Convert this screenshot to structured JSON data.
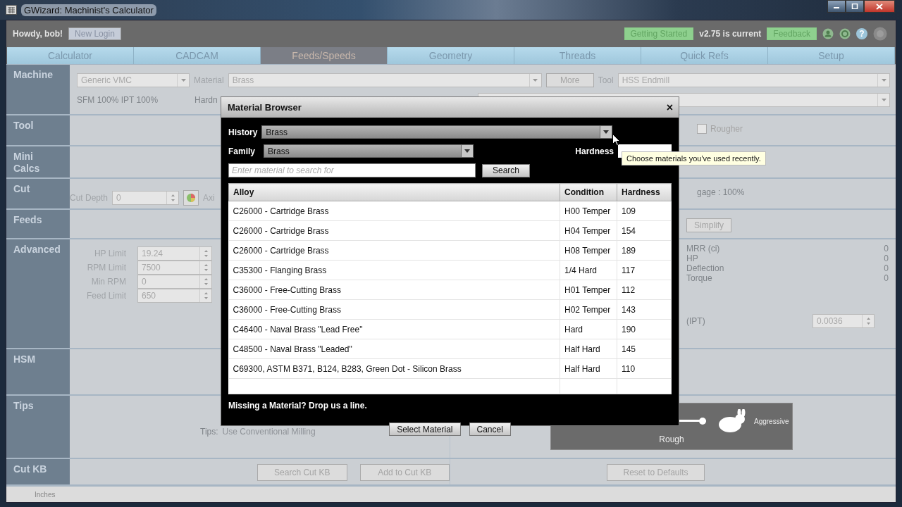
{
  "window": {
    "title": "GWizard: Machinist's Calculator"
  },
  "header": {
    "greeting": "Howdy, bob!",
    "new_login": "New Login",
    "getting_started": "Getting Started",
    "version": "v2.75 is current",
    "feedback": "Feedback",
    "help": "?"
  },
  "tabs": [
    {
      "label": "Calculator",
      "selected": false
    },
    {
      "label": "CADCAM",
      "selected": false
    },
    {
      "label": "Feeds/Speeds",
      "selected": true
    },
    {
      "label": "Geometry",
      "selected": false
    },
    {
      "label": "Threads",
      "selected": false
    },
    {
      "label": "Quick Refs",
      "selected": false
    },
    {
      "label": "Setup",
      "selected": false
    }
  ],
  "machine": {
    "label": "Machine",
    "machine_value": "Generic VMC",
    "material_label": "Material",
    "material_value": "Brass",
    "more": "More",
    "tool_label": "Tool",
    "tool_value": "HSS Endmill",
    "stats": "SFM 100%  IPT 100%",
    "hardness": "Hardn"
  },
  "tool": {
    "label": "Tool",
    "rougher": {
      "label": "Rougher",
      "checked": false
    }
  },
  "mini_calcs": {
    "label": "Mini Calcs"
  },
  "cut": {
    "label": "Cut",
    "depth_label": "Cut Depth",
    "depth_value": "0",
    "axial": "Axi",
    "engagement": "gage : 100%"
  },
  "feeds": {
    "label": "Feeds",
    "simplify": "Simplify"
  },
  "advanced": {
    "label": "Advanced",
    "limits": [
      {
        "label": "HP Limit",
        "value": "19.24"
      },
      {
        "label": "RPM Limit",
        "value": "7500"
      },
      {
        "label": "Min RPM",
        "value": "0"
      },
      {
        "label": "Feed Limit",
        "value": "650"
      }
    ],
    "readouts": [
      {
        "label": "MRR (ci)",
        "value": "0"
      },
      {
        "label": "HP",
        "value": "0"
      },
      {
        "label": "Deflection",
        "value": "0"
      },
      {
        "label": "Torque",
        "value": "0"
      }
    ],
    "ipt_label": "(IPT)",
    "ipt_value": "0.0036"
  },
  "hsm": {
    "label": "HSM"
  },
  "tips": {
    "label": "Tips",
    "tips_label": "Tips:",
    "tip": "Use Conventional Milling",
    "slider": {
      "level": 1,
      "low": "Rough",
      "high": "Aggressive"
    }
  },
  "cut_kb": {
    "label": "Cut KB",
    "buttons": [
      "Search Cut KB",
      "Add to Cut KB",
      "Reset to Defaults"
    ]
  },
  "status_bar": {
    "units": "Inches"
  },
  "dialog": {
    "title": "Material Browser",
    "close": "×",
    "history_label": "History",
    "history_value": "Brass",
    "family_label": "Family",
    "family_value": "Brass",
    "hardness_label": "Hardness",
    "search_placeholder": "Enter material to search for",
    "search_button": "Search",
    "columns": [
      "Alloy",
      "Condition",
      "Hardness"
    ],
    "rows": [
      [
        "C26000 - Cartridge Brass",
        "H00 Temper",
        "109"
      ],
      [
        "C26000 - Cartridge Brass",
        "H04 Temper",
        "154"
      ],
      [
        "C26000 - Cartridge Brass",
        "H08 Temper",
        "189"
      ],
      [
        "C35300 - Flanging Brass",
        "1/4 Hard",
        "117"
      ],
      [
        "C36000 - Free-Cutting Brass",
        "H01 Temper",
        "112"
      ],
      [
        "C36000 - Free-Cutting Brass",
        "H02 Temper",
        "143"
      ],
      [
        "C46400 - Naval Brass \"Lead Free\"",
        "Hard",
        "190"
      ],
      [
        "C48500 - Naval Brass \"Leaded\"",
        "Half Hard",
        "145"
      ],
      [
        "C69300, ASTM B371, B124, B283, Green Dot - Silicon Brass",
        "Half Hard",
        "110"
      ]
    ],
    "missing": "Missing a Material? Drop us a line.",
    "buttons": [
      "Select Material",
      "Cancel"
    ],
    "tooltip": "Choose materials you've used recently."
  }
}
